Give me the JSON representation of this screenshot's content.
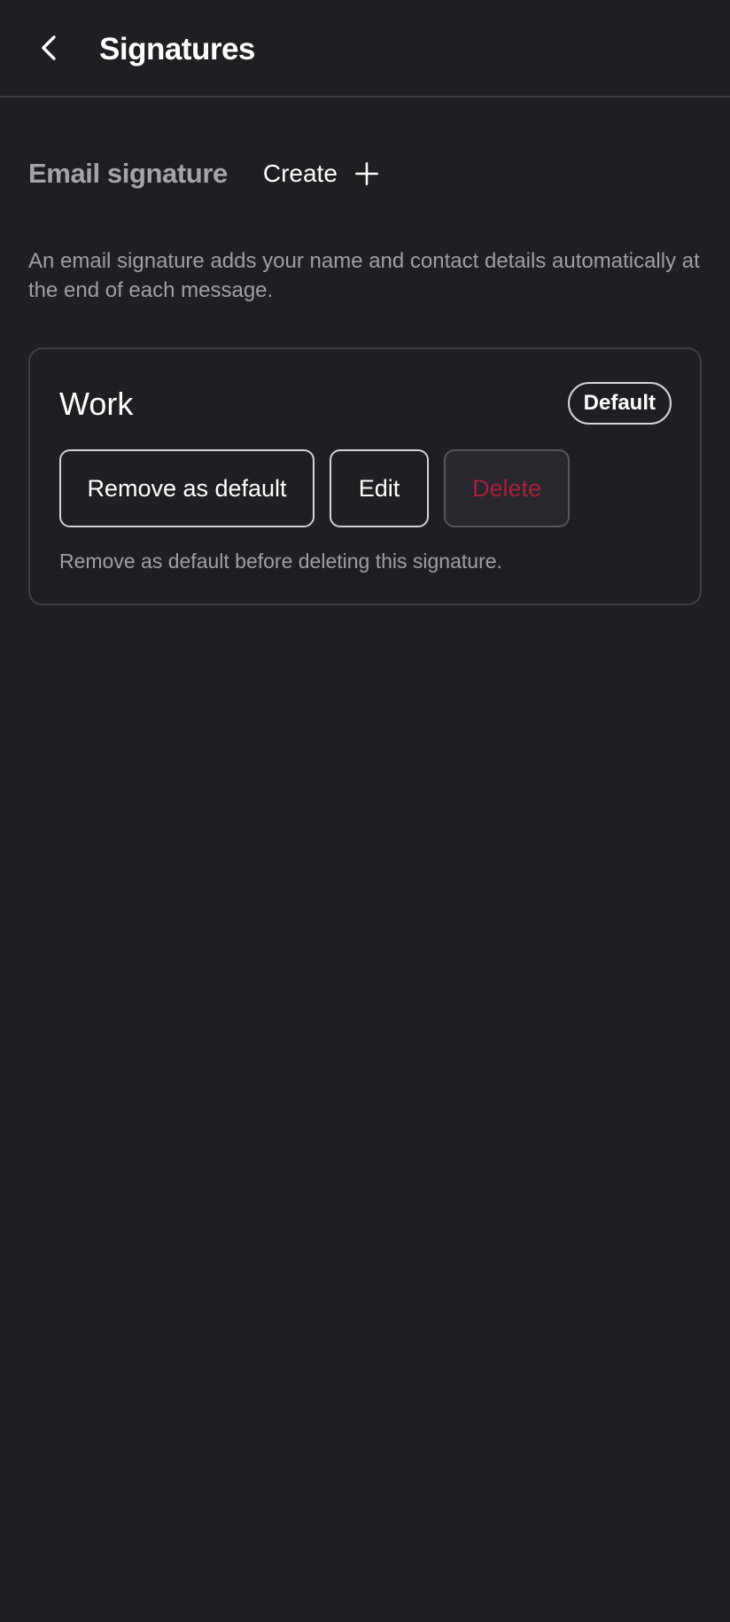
{
  "header": {
    "title": "Signatures",
    "back_icon": "chevron-left-icon"
  },
  "section": {
    "title": "Email signature",
    "create_label": "Create",
    "create_icon": "plus-icon",
    "description": "An email signature adds your name and contact details automatically at the end of each message."
  },
  "signature": {
    "name": "Work",
    "badge": "Default",
    "remove_default_label": "Remove as default",
    "edit_label": "Edit",
    "delete_label": "Delete",
    "delete_disabled": true,
    "hint": "Remove as default before deleting this signature."
  },
  "colors": {
    "background": "#1f1e23",
    "divider": "#3e3d43",
    "muted_text": "#a09fa6",
    "delete_text": "#a4203f"
  }
}
